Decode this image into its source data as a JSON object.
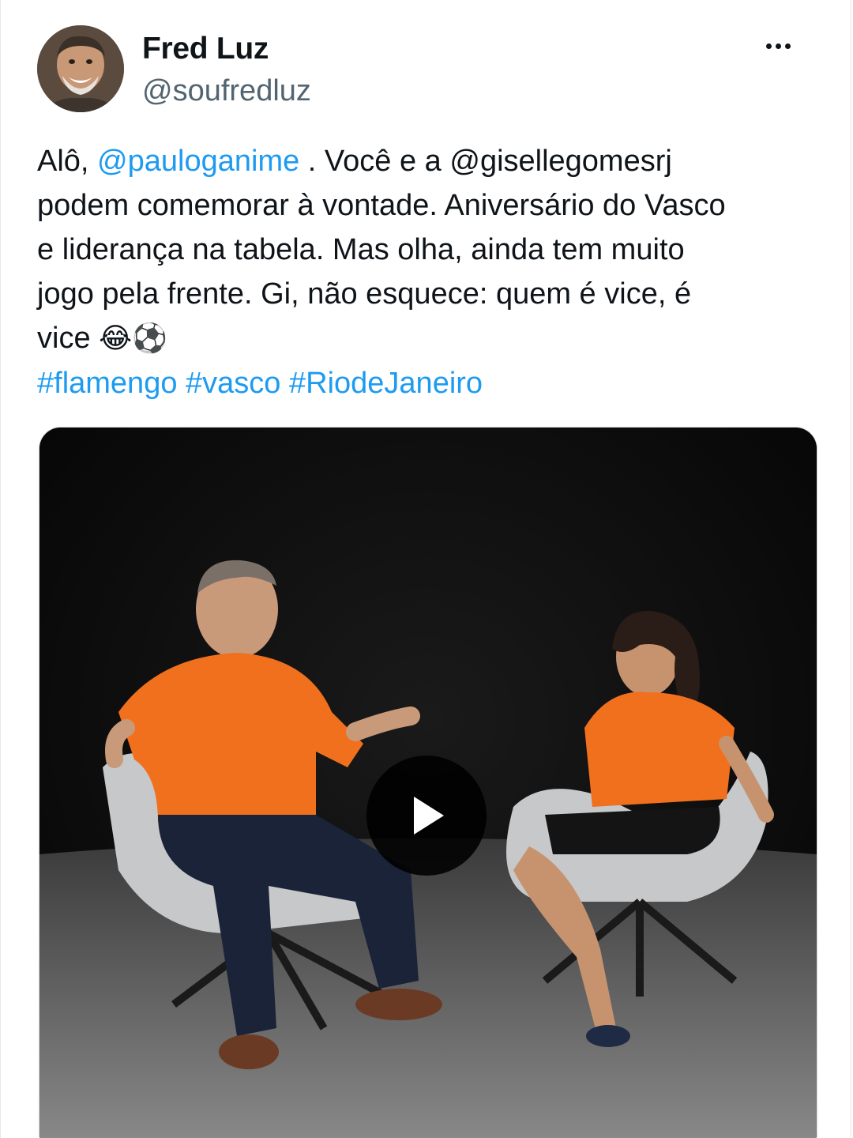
{
  "author": {
    "display_name": "Fred Luz",
    "handle": "@soufredluz"
  },
  "tweet": {
    "line1": {
      "prefix": "Alô, ",
      "mention": "@pauloganime",
      "suffix": " . Você e a @gisellegomesrj"
    },
    "line2": "podem comemorar à vontade. Aniversário do Vasco",
    "line3": "e liderança na tabela. Mas olha, ainda tem muito",
    "line4": "jogo pela frente. Gi, não esquece: quem é vice, é",
    "line5": "vice",
    "emoji_laugh": "😂",
    "emoji_ball": "⚽",
    "hashtags": [
      "#flamengo",
      "#vasco",
      "#RiodeJaneiro"
    ]
  },
  "media": {
    "type": "video",
    "play_icon": "play-icon"
  },
  "icons": {
    "more": "more-options-icon"
  },
  "colors": {
    "link": "#1d9bf0",
    "text": "#0f1419",
    "secondary": "#536471",
    "shirt": "#f0701e"
  }
}
